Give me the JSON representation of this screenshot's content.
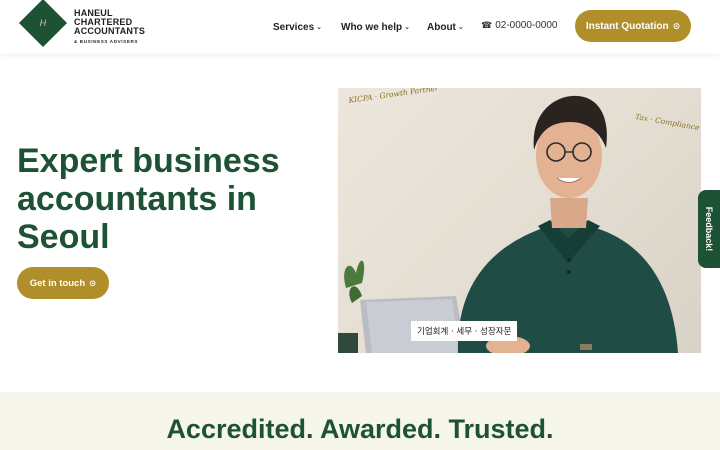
{
  "brand": {
    "line1": "HANEUL",
    "line2": "CHARTERED",
    "line3": "ACCOUNTANTS",
    "tagline": "& BUSINESS ADVISERS",
    "mark": "H",
    "color_primary": "#1e5234",
    "color_accent": "#b08f2b"
  },
  "nav": {
    "services": "Services",
    "who_we_help": "Who we help",
    "about": "About",
    "phone": "02-0000-0000",
    "phone_icon": "☎",
    "chevron": "⌄",
    "quote_button": "Instant Quotation",
    "arrow_icon": "⊙"
  },
  "hero": {
    "title": "Expert business accountants in Seoul",
    "cta": "Get in touch",
    "image": {
      "note_left": "KICPA · Growth Partner",
      "note_right": "Tax · Compliance",
      "caption": "기업회계 · 세무 · 성장자문"
    }
  },
  "feedback": {
    "label": "Feedback!"
  },
  "section": {
    "title": "Accredited. Awarded. Trusted."
  }
}
